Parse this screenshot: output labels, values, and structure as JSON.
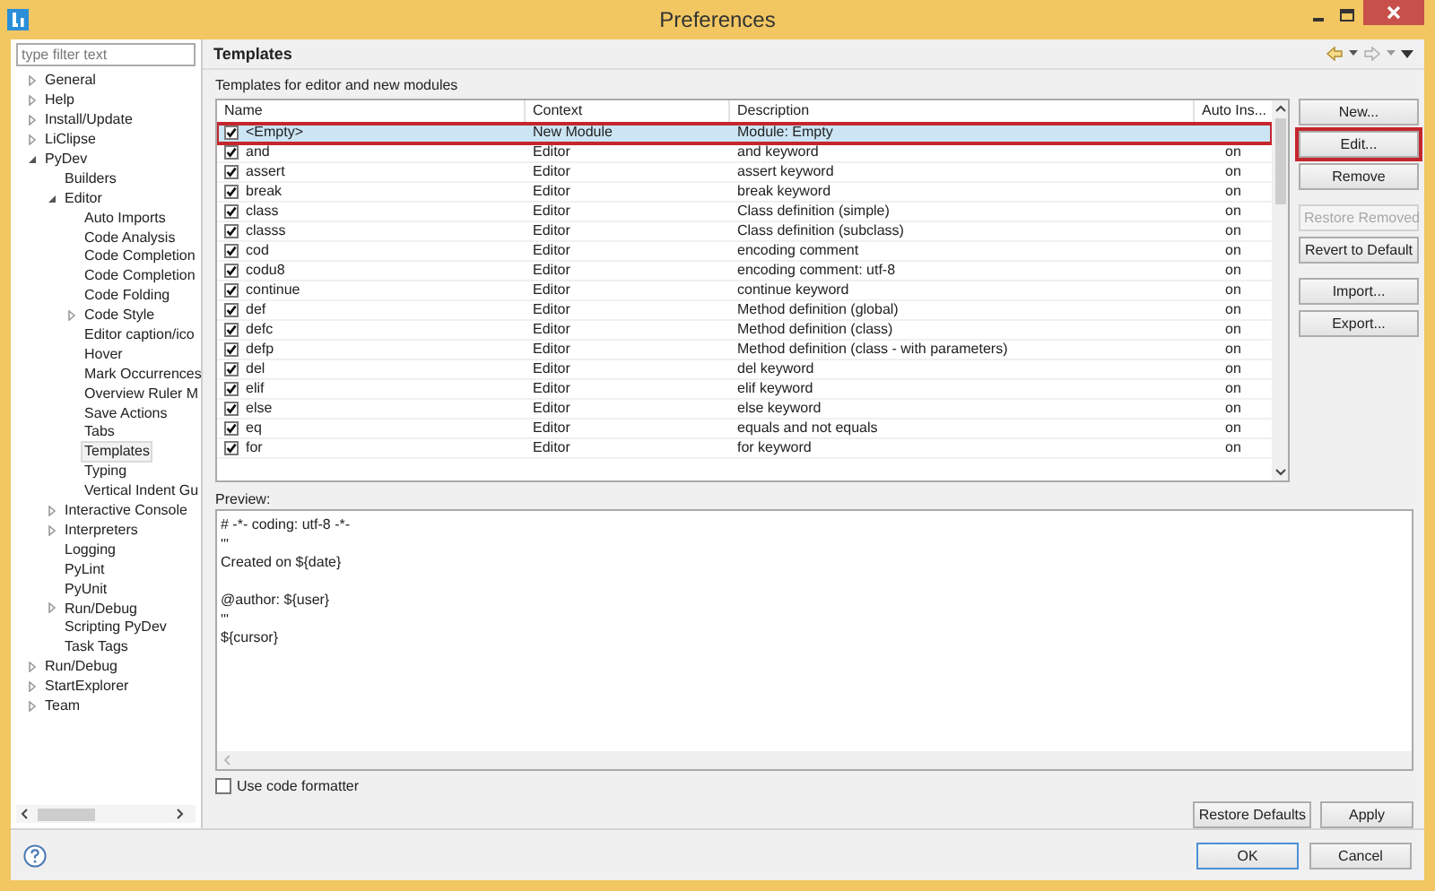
{
  "window": {
    "title": "Preferences"
  },
  "filter": {
    "placeholder": "type filter text"
  },
  "tree": [
    {
      "label": "General",
      "expanded": false,
      "selected": false
    },
    {
      "label": "Help",
      "expanded": false,
      "selected": false
    },
    {
      "label": "Install/Update",
      "expanded": false,
      "selected": false
    },
    {
      "label": "LiClipse",
      "expanded": false,
      "selected": false
    },
    {
      "label": "PyDev",
      "expanded": true,
      "selected": false,
      "children": [
        {
          "label": "Builders",
          "selected": false
        },
        {
          "label": "Editor",
          "expanded": true,
          "selected": false,
          "children": [
            {
              "label": "Auto Imports",
              "selected": false
            },
            {
              "label": "Code Analysis",
              "selected": false
            },
            {
              "label": "Code Completion",
              "selected": false
            },
            {
              "label": "Code Completion",
              "selected": false
            },
            {
              "label": "Code Folding",
              "selected": false
            },
            {
              "label": "Code Style",
              "expanded": false,
              "selected": false
            },
            {
              "label": "Editor caption/ico",
              "selected": false
            },
            {
              "label": "Hover",
              "selected": false
            },
            {
              "label": "Mark Occurrences",
              "selected": false
            },
            {
              "label": "Overview Ruler M",
              "selected": false
            },
            {
              "label": "Save Actions",
              "selected": false
            },
            {
              "label": "Tabs",
              "selected": false
            },
            {
              "label": "Templates",
              "selected": true
            },
            {
              "label": "Typing",
              "selected": false
            },
            {
              "label": "Vertical Indent Gu",
              "selected": false
            }
          ]
        },
        {
          "label": "Interactive Console",
          "expanded": false,
          "selected": false
        },
        {
          "label": "Interpreters",
          "expanded": false,
          "selected": false
        },
        {
          "label": "Logging",
          "selected": false
        },
        {
          "label": "PyLint",
          "selected": false
        },
        {
          "label": "PyUnit",
          "selected": false
        },
        {
          "label": "Run/Debug",
          "expanded": false,
          "selected": false
        },
        {
          "label": "Scripting PyDev",
          "selected": false
        },
        {
          "label": "Task Tags",
          "selected": false
        }
      ]
    },
    {
      "label": "Run/Debug",
      "expanded": false,
      "selected": false
    },
    {
      "label": "StartExplorer",
      "expanded": false,
      "selected": false
    },
    {
      "label": "Team",
      "expanded": false,
      "selected": false
    }
  ],
  "page": {
    "title": "Templates",
    "subtitle": "Templates for editor and new modules"
  },
  "table": {
    "columns": [
      "Name",
      "Context",
      "Description",
      "Auto Ins..."
    ],
    "rows": [
      {
        "name": "<Empty>",
        "context": "New Module",
        "description": "Module: Empty",
        "checked": true,
        "selected": true,
        "highlighted": true
      },
      {
        "name": "and",
        "context": "Editor",
        "description": "and keyword",
        "auto_insert": "on",
        "checked": true,
        "selected": false,
        "highlighted": false
      },
      {
        "name": "assert",
        "context": "Editor",
        "description": "assert keyword",
        "auto_insert": "on",
        "checked": true,
        "selected": false,
        "highlighted": false
      },
      {
        "name": "break",
        "context": "Editor",
        "description": "break keyword",
        "auto_insert": "on",
        "checked": true,
        "selected": false,
        "highlighted": false
      },
      {
        "name": "class",
        "context": "Editor",
        "description": "Class definition (simple)",
        "auto_insert": "on",
        "checked": true,
        "selected": false,
        "highlighted": false
      },
      {
        "name": "classs",
        "context": "Editor",
        "description": "Class definition (subclass)",
        "auto_insert": "on",
        "checked": true,
        "selected": false,
        "highlighted": false
      },
      {
        "name": "cod",
        "context": "Editor",
        "description": "encoding comment",
        "auto_insert": "on",
        "checked": true,
        "selected": false,
        "highlighted": false
      },
      {
        "name": "codu8",
        "context": "Editor",
        "description": "encoding comment: utf-8",
        "auto_insert": "on",
        "checked": true,
        "selected": false,
        "highlighted": false
      },
      {
        "name": "continue",
        "context": "Editor",
        "description": "continue keyword",
        "auto_insert": "on",
        "checked": true,
        "selected": false,
        "highlighted": false
      },
      {
        "name": "def",
        "context": "Editor",
        "description": "Method definition (global)",
        "auto_insert": "on",
        "checked": true,
        "selected": false,
        "highlighted": false
      },
      {
        "name": "defc",
        "context": "Editor",
        "description": "Method definition (class)",
        "auto_insert": "on",
        "checked": true,
        "selected": false,
        "highlighted": false
      },
      {
        "name": "defp",
        "context": "Editor",
        "description": "Method definition (class - with parameters)",
        "auto_insert": "on",
        "checked": true,
        "selected": false,
        "highlighted": false
      },
      {
        "name": "del",
        "context": "Editor",
        "description": "del keyword",
        "auto_insert": "on",
        "checked": true,
        "selected": false,
        "highlighted": false
      },
      {
        "name": "elif",
        "context": "Editor",
        "description": "elif keyword",
        "auto_insert": "on",
        "checked": true,
        "selected": false,
        "highlighted": false
      },
      {
        "name": "else",
        "context": "Editor",
        "description": "else keyword",
        "auto_insert": "on",
        "checked": true,
        "selected": false,
        "highlighted": false
      },
      {
        "name": "eq",
        "context": "Editor",
        "description": "equals and not equals",
        "auto_insert": "on",
        "checked": true,
        "selected": false,
        "highlighted": false
      },
      {
        "name": "for",
        "context": "Editor",
        "description": "for keyword",
        "auto_insert": "on",
        "checked": true,
        "selected": false,
        "highlighted": false
      }
    ]
  },
  "side_buttons": [
    {
      "label": "New...",
      "disabled": false,
      "highlighted": false
    },
    {
      "label": "Edit...",
      "disabled": false,
      "highlighted": true
    },
    {
      "label": "Remove",
      "disabled": false,
      "highlighted": false
    },
    {
      "label": "Restore Removed",
      "disabled": true,
      "highlighted": false
    },
    {
      "label": "Revert to Default",
      "disabled": false,
      "highlighted": false
    },
    {
      "label": "Import...",
      "disabled": false,
      "highlighted": false
    },
    {
      "label": "Export...",
      "disabled": false,
      "highlighted": false
    }
  ],
  "preview": {
    "label": "Preview:",
    "text": "# -*- coding: utf-8 -*-\n'''\nCreated on ${date}\n\n@author: ${user}\n'''\n${cursor}"
  },
  "code_formatter": {
    "label": "Use code formatter",
    "checked": false
  },
  "page_buttons": [
    "Restore Defaults",
    "Apply"
  ],
  "dialog_buttons": [
    {
      "label": "OK",
      "default": true
    },
    {
      "label": "Cancel",
      "default": false
    }
  ]
}
